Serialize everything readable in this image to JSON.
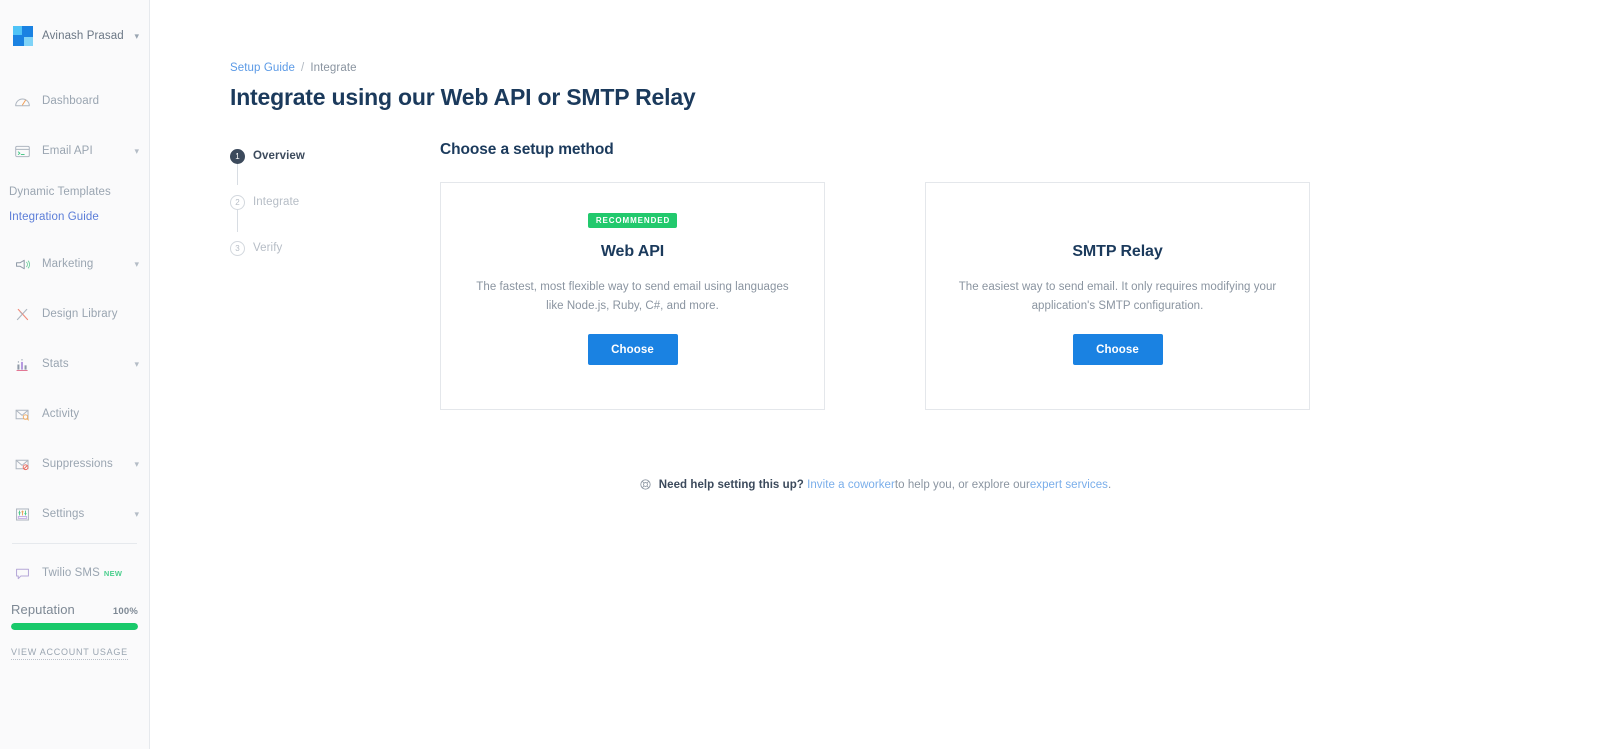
{
  "sidebar": {
    "account": {
      "name": "Avinash Prasad",
      "caret": "chevron-down-icon"
    },
    "nav": [
      {
        "label": "Dashboard",
        "icon": "gauge-icon",
        "caret": ""
      },
      {
        "label": "Email API",
        "icon": "terminal-icon",
        "caret": "⌄"
      }
    ],
    "sub_items": [
      {
        "label": "Dynamic Templates",
        "active": false
      },
      {
        "label": "Integration Guide",
        "active": true
      }
    ],
    "nav2": [
      {
        "label": "Marketing",
        "icon": "megaphone-icon",
        "caret": "⌄"
      },
      {
        "label": "Design Library",
        "icon": "pencil-ruler-icon",
        "caret": ""
      },
      {
        "label": "Stats",
        "icon": "bar-chart-icon",
        "caret": "⌄"
      },
      {
        "label": "Activity",
        "icon": "envelope-search-icon",
        "caret": ""
      },
      {
        "label": "Suppressions",
        "icon": "envelope-block-icon",
        "caret": "⌄"
      },
      {
        "label": "Settings",
        "icon": "sliders-icon",
        "caret": "⌄"
      }
    ],
    "twilio": {
      "label": "Twilio SMS",
      "badge": "NEW",
      "icon": "chat-bubble-icon"
    },
    "reputation": {
      "label": "Reputation",
      "percent_label": "100%",
      "percent_value": 100,
      "bar_color": "#19c96a"
    },
    "view_account_usage": "VIEW ACCOUNT USAGE"
  },
  "breadcrumb": {
    "root": "Setup Guide",
    "separator": "/",
    "current": "Integrate"
  },
  "page_title": "Integrate using our Web API or SMTP Relay",
  "stepper": [
    {
      "number": "1",
      "label": "Overview",
      "state": "done"
    },
    {
      "number": "2",
      "label": "Integrate",
      "state": "todo"
    },
    {
      "number": "3",
      "label": "Verify",
      "state": "todo"
    }
  ],
  "section_title": "Choose a setup method",
  "cards": [
    {
      "badge": "RECOMMENDED",
      "has_badge": true,
      "title": "Web API",
      "description": "The fastest, most flexible way to send email using languages like Node.js, Ruby, C#, and more.",
      "button": "Choose"
    },
    {
      "badge": "",
      "has_badge": false,
      "title": "SMTP Relay",
      "description": "The easiest way to send email. It only requires modifying your application's SMTP configuration.",
      "button": "Choose"
    }
  ],
  "help": {
    "icon": "lifebuoy-icon",
    "strong": "Need help setting this up?",
    "link1": "Invite a coworker",
    "mid": " to help you, or explore our ",
    "link2": "expert services",
    "end": "."
  },
  "colors": {
    "accent_blue": "#1a82e2",
    "badge_green": "#22c96d",
    "reputation_green": "#19c96a",
    "title_navy": "#1b3a5c",
    "link_blue": "#5b9ae6",
    "sidebar_bg": "#fafafb"
  }
}
